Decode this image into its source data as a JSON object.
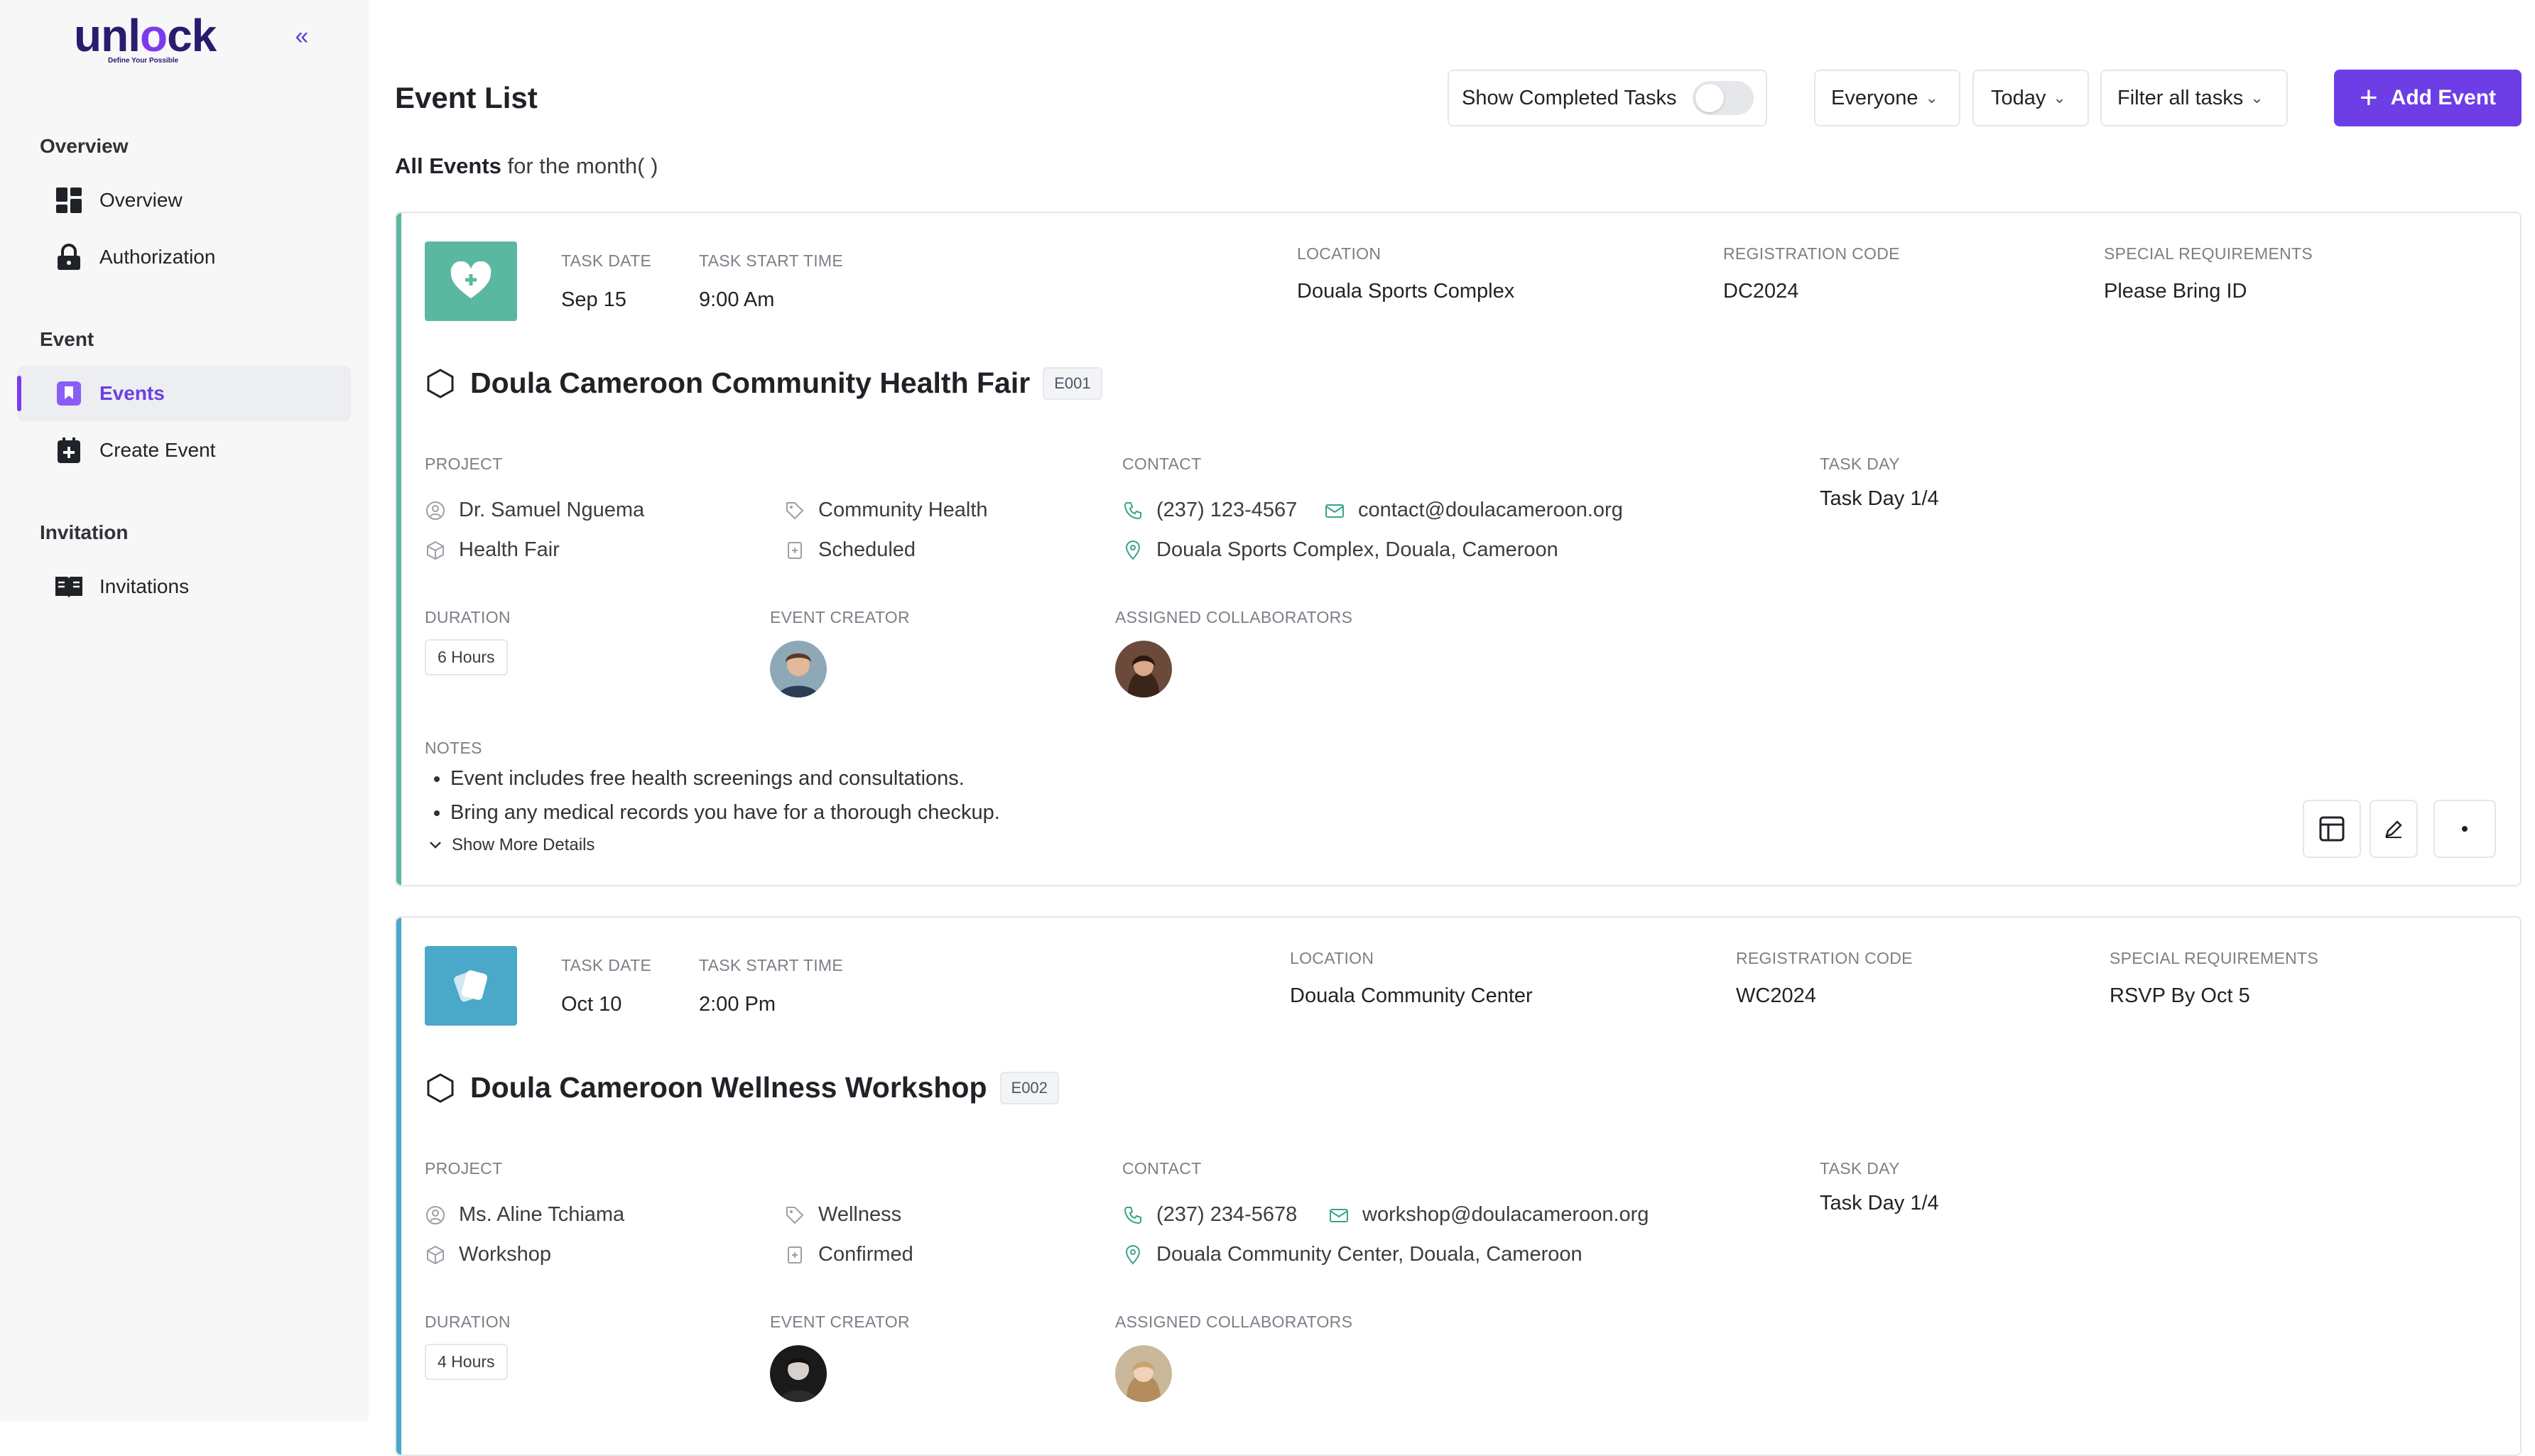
{
  "sidebar": {
    "logo": {
      "part1": "unl",
      "part2": "o",
      "part3": "ck",
      "tagline": "Define Your Possible"
    },
    "collapse_icon": "double-chevron-left-icon",
    "sections": [
      {
        "title": "Overview",
        "items": [
          {
            "label": "Overview",
            "icon": "dashboard-icon"
          },
          {
            "label": "Authorization",
            "icon": "lock-icon"
          }
        ]
      },
      {
        "title": "Event",
        "items": [
          {
            "label": "Events",
            "icon": "bookmark-icon",
            "active": true
          },
          {
            "label": "Create Event",
            "icon": "add-calendar-icon"
          }
        ]
      },
      {
        "title": "Invitation",
        "items": [
          {
            "label": "Invitations",
            "icon": "book-open-icon"
          }
        ]
      }
    ]
  },
  "header": {
    "title": "Event List",
    "subtitle_bold": "All Events",
    "subtitle_rest": " for the month( )",
    "show_completed_label": "Show Completed Tasks",
    "show_completed_on": false,
    "everyone_label": "Everyone",
    "today_label": "Today",
    "filter_label": "Filter all tasks",
    "add_label": "Add Event"
  },
  "labels": {
    "task_date": "TASK DATE",
    "task_start_time": "TASK START TIME",
    "location": "LOCATION",
    "registration_code": "REGISTRATION CODE",
    "special_requirements": "SPECIAL REQUIREMENTS",
    "project": "PROJECT",
    "contact": "CONTACT",
    "task_day": "TASK DAY",
    "duration": "DURATION",
    "event_creator": "EVENT CREATOR",
    "assigned_collaborators": "ASSIGNED COLLABORATORS",
    "notes": "NOTES",
    "show_more": "Show More Details"
  },
  "events": [
    {
      "accent": "#5bb8a0",
      "icon": "heart-plus-icon",
      "date": "Sep 15",
      "start_time": "9:00 Am",
      "location": "Douala Sports Complex",
      "registration_code": "DC2024",
      "special_requirements": "Please Bring ID",
      "title": "Doula Cameroon Community Health Fair",
      "code": "E001",
      "organizer": "Dr. Samuel Nguema",
      "category": "Community Health",
      "type": "Health Fair",
      "status": "Scheduled",
      "phone": "(237) 123-4567",
      "email": "contact@doulacameroon.org",
      "address": "Douala Sports Complex, Douala, Cameroon",
      "task_day": "Task Day 1/4",
      "duration": "6 Hours",
      "notes": [
        "Event includes free health screenings and consultations.",
        "Bring any medical records you have for a thorough checkup."
      ]
    },
    {
      "accent": "#4aa8c8",
      "icon": "cards-icon",
      "date": "Oct 10",
      "start_time": "2:00 Pm",
      "location": "Douala Community Center",
      "registration_code": "WC2024",
      "special_requirements": "RSVP By Oct 5",
      "title": "Doula Cameroon Wellness Workshop",
      "code": "E002",
      "organizer": "Ms. Aline Tchiama",
      "category": "Wellness",
      "type": "Workshop",
      "status": "Confirmed",
      "phone": "(237) 234-5678",
      "email": "workshop@doulacameroon.org",
      "address": "Douala Community Center, Douala, Cameroon",
      "task_day": "Task Day 1/4",
      "duration": "4 Hours"
    }
  ],
  "colors": {
    "brand": "#6d3ee6",
    "brand_dark": "#2b1b6e",
    "border": "#e5e7eb",
    "accent_health": "#5bb8a0",
    "accent_wellness": "#4aa8c8"
  }
}
